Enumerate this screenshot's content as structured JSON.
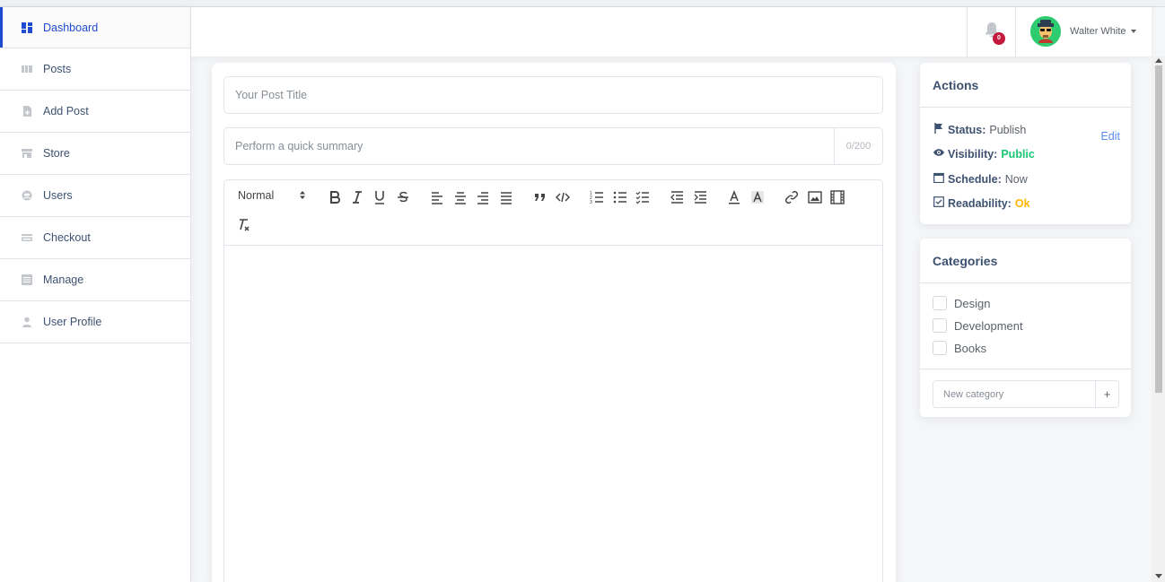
{
  "sidebar": {
    "items": [
      {
        "label": "Dashboard",
        "icon": "dashboard-icon",
        "active": true
      },
      {
        "label": "Posts",
        "icon": "posts-icon"
      },
      {
        "label": "Add Post",
        "icon": "add-post-icon"
      },
      {
        "label": "Store",
        "icon": "store-icon"
      },
      {
        "label": "Users",
        "icon": "users-icon"
      },
      {
        "label": "Checkout",
        "icon": "credit-card-icon"
      },
      {
        "label": "Manage",
        "icon": "list-icon"
      },
      {
        "label": "User Profile",
        "icon": "person-icon"
      }
    ]
  },
  "header": {
    "notification_count": "0",
    "user_name": "Walter White"
  },
  "editor": {
    "title_placeholder": "Your Post Title",
    "summary_placeholder": "Perform a quick summary",
    "summary_counter": "0/200",
    "format_select": "Normal"
  },
  "actions": {
    "title": "Actions",
    "status_label": "Status:",
    "status_value": "Publish",
    "edit_label": "Edit",
    "visibility_label": "Visibility:",
    "visibility_value": "Public",
    "schedule_label": "Schedule:",
    "schedule_value": "Now",
    "readability_label": "Readability:",
    "readability_value": "Ok"
  },
  "categories": {
    "title": "Categories",
    "items": [
      "Design",
      "Development",
      "Books"
    ],
    "new_placeholder": "New category",
    "add_label": "+"
  },
  "colors": {
    "accent": "#1f4bd0",
    "success": "#17c671",
    "warning": "#ffb400",
    "danger": "#c4183c"
  }
}
